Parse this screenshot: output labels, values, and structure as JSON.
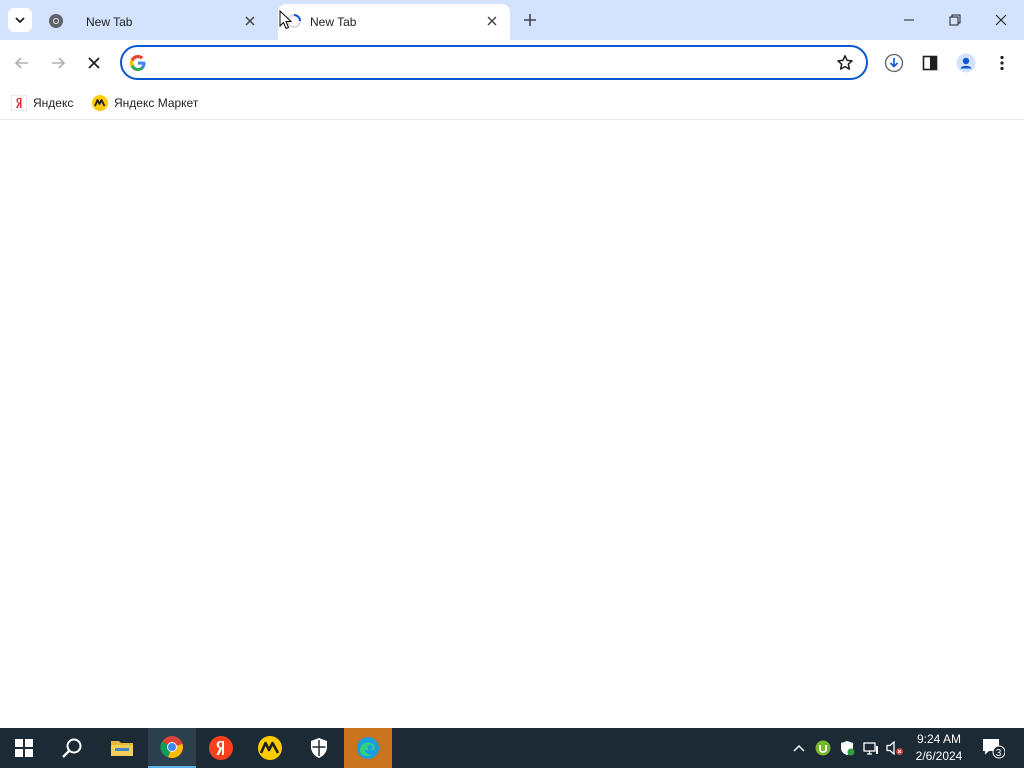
{
  "tabs": [
    {
      "title": "New Tab",
      "state": "inactive"
    },
    {
      "title": "New Tab",
      "state": "active-loading"
    }
  ],
  "window_controls": {
    "minimize": "minimize-icon",
    "restore": "restore-icon",
    "close": "close-icon"
  },
  "omnibox": {
    "value": "",
    "placeholder": ""
  },
  "bookmarks": [
    {
      "label": "Яндекс",
      "icon": "yandex-icon"
    },
    {
      "label": "Яндекс Маркет",
      "icon": "yandex-market-icon"
    }
  ],
  "taskbar": {
    "apps": [
      "start",
      "search",
      "file-explorer",
      "chrome",
      "yandex-browser",
      "yandex-market",
      "windows-security",
      "edge"
    ],
    "clock_time": "9:24 AM",
    "clock_date": "2/6/2024",
    "notification_count": "3"
  },
  "colors": {
    "tabstrip": "#d3e3fd",
    "omnibox_border": "#0b57d0",
    "taskbar": "#1c2a35"
  }
}
